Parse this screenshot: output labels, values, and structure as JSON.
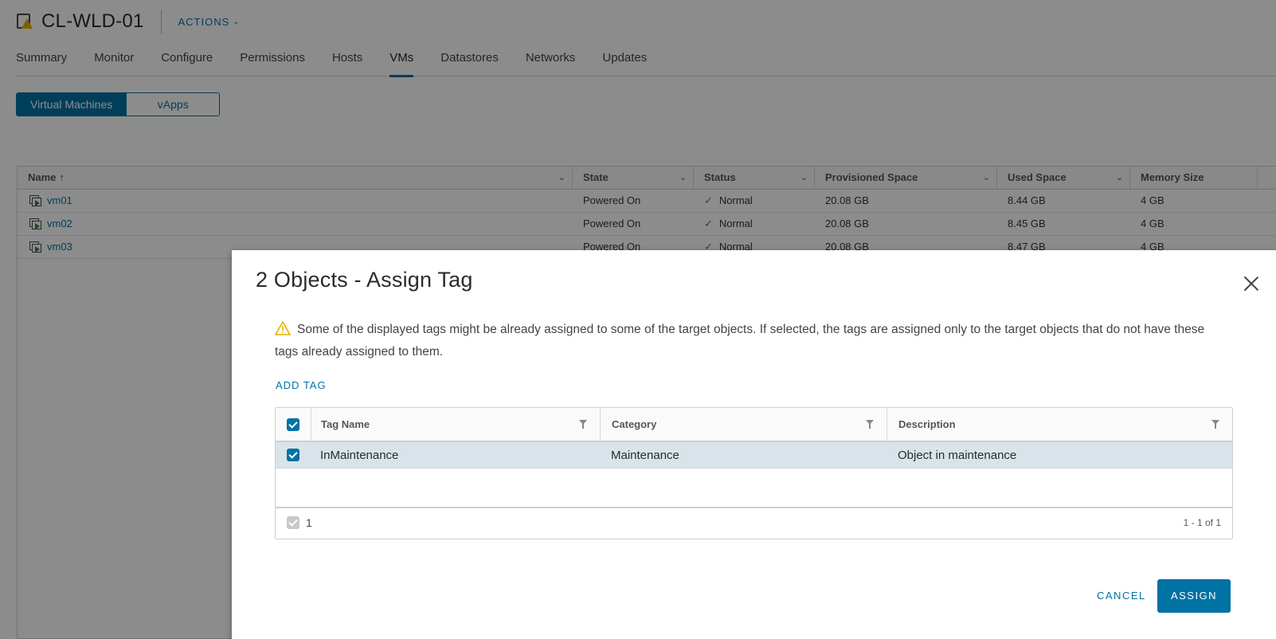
{
  "object": {
    "title": "CL-WLD-01",
    "actions_label": "ACTIONS"
  },
  "tabs": [
    {
      "label": "Summary"
    },
    {
      "label": "Monitor"
    },
    {
      "label": "Configure"
    },
    {
      "label": "Permissions"
    },
    {
      "label": "Hosts"
    },
    {
      "label": "VMs",
      "active": true
    },
    {
      "label": "Datastores"
    },
    {
      "label": "Networks"
    },
    {
      "label": "Updates"
    }
  ],
  "view_toggle": {
    "options": [
      "Virtual Machines",
      "vApps"
    ],
    "selected": "Virtual Machines"
  },
  "vm_table": {
    "columns": [
      "Name",
      "State",
      "Status",
      "Provisioned Space",
      "Used Space",
      "Memory Size"
    ],
    "rows": [
      {
        "name": "vm01",
        "state": "Powered On",
        "status": "Normal",
        "provisioned": "20.08 GB",
        "used": "8.44 GB",
        "memory": "4 GB"
      },
      {
        "name": "vm02",
        "state": "Powered On",
        "status": "Normal",
        "provisioned": "20.08 GB",
        "used": "8.45 GB",
        "memory": "4 GB"
      },
      {
        "name": "vm03",
        "state": "Powered On",
        "status": "Normal",
        "provisioned": "20.08 GB",
        "used": "8.47 GB",
        "memory": "4 GB"
      }
    ]
  },
  "dialog": {
    "title": "2 Objects - Assign Tag",
    "warning": "Some of the displayed tags might be already assigned to some of the target objects. If selected, the tags are assigned only to the target objects that do not have these tags already assigned to them.",
    "add_tag_label": "ADD TAG",
    "tag_table": {
      "columns": [
        "Tag Name",
        "Category",
        "Description"
      ],
      "rows": [
        {
          "tag_name": "InMaintenance",
          "category": "Maintenance",
          "description": "Object in maintenance",
          "checked": true
        }
      ],
      "selected_count": "1",
      "pagination": "1 - 1 of 1"
    },
    "cancel_label": "CANCEL",
    "assign_label": "ASSIGN"
  },
  "colors": {
    "accent": "#0072a3",
    "selected_row": "#d9e4ea",
    "warning": "#e6b000",
    "ok": "#3c8f3c"
  }
}
